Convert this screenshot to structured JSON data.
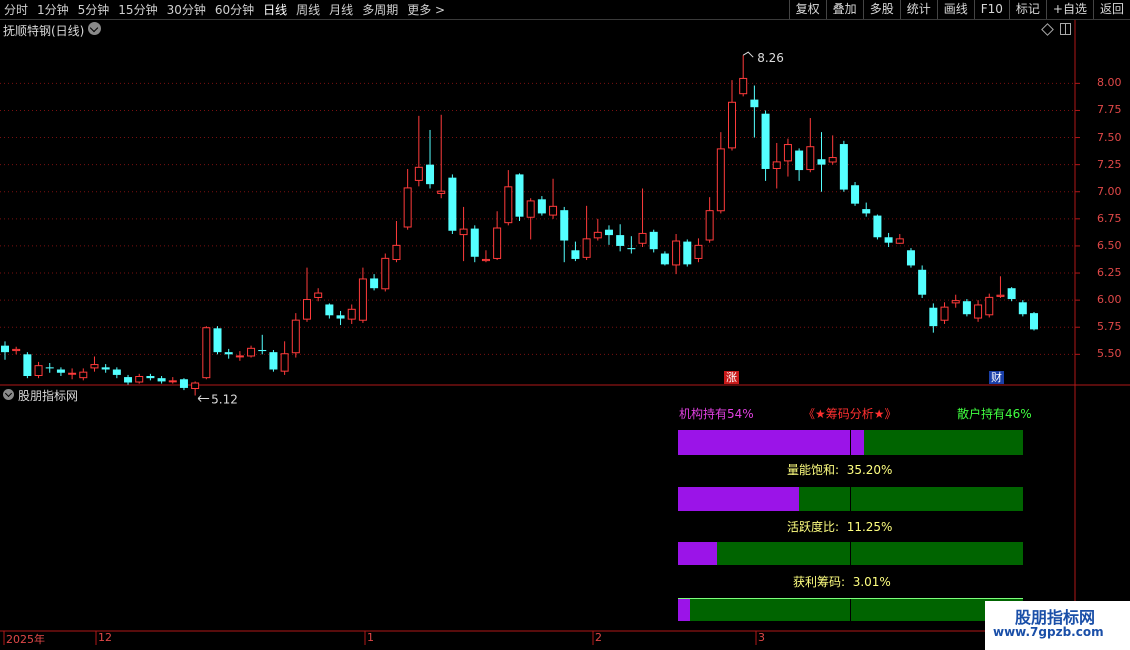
{
  "toolbar": {
    "periods": [
      "分时",
      "1分钟",
      "5分钟",
      "15分钟",
      "30分钟",
      "60分钟",
      "日线",
      "周线",
      "月线",
      "多周期",
      "更多 >"
    ],
    "active_period": "日线",
    "actions": [
      "复权",
      "叠加",
      "多股",
      "统计",
      "画线",
      "F10",
      "标记",
      "+自选",
      "返回"
    ]
  },
  "main_chart": {
    "stock_title": "抚顺特钢(日线)",
    "high_label": "8.26",
    "low_label": "5.12",
    "price_ticks": [
      "8.00",
      "7.75",
      "7.50",
      "7.25",
      "7.00",
      "6.75",
      "6.50",
      "6.25",
      "6.00",
      "5.75",
      "5.50"
    ],
    "markers": [
      {
        "text": "涨",
        "color": "#c81a1a"
      },
      {
        "text": "财",
        "color": "#1a3fa8"
      }
    ],
    "colors": {
      "up": "#ff3b3b",
      "down": "#54ffff",
      "axis": "#b01818"
    }
  },
  "chart_data": {
    "type": "candlestick",
    "ylim": [
      5.3,
      8.4
    ],
    "candles": [
      [
        5.58,
        5.52,
        5.62,
        5.45
      ],
      [
        5.53,
        5.55,
        5.57,
        5.5
      ],
      [
        5.5,
        5.3,
        5.52,
        5.28
      ],
      [
        5.3,
        5.4,
        5.43,
        5.28
      ],
      [
        5.38,
        5.37,
        5.42,
        5.33
      ],
      [
        5.36,
        5.33,
        5.38,
        5.3
      ],
      [
        5.33,
        5.33,
        5.37,
        5.27
      ],
      [
        5.28,
        5.34,
        5.37,
        5.26
      ],
      [
        5.37,
        5.41,
        5.48,
        5.34
      ],
      [
        5.38,
        5.36,
        5.41,
        5.33
      ],
      [
        5.36,
        5.31,
        5.38,
        5.28
      ],
      [
        5.29,
        5.24,
        5.31,
        5.22
      ],
      [
        5.24,
        5.3,
        5.32,
        5.23
      ],
      [
        5.3,
        5.28,
        5.32,
        5.26
      ],
      [
        5.28,
        5.25,
        5.3,
        5.23
      ],
      [
        5.26,
        5.26,
        5.29,
        5.23
      ],
      [
        5.27,
        5.19,
        5.28,
        5.17
      ],
      [
        5.18,
        5.24,
        5.25,
        5.12
      ],
      [
        5.28,
        5.75,
        5.76,
        5.27
      ],
      [
        5.74,
        5.52,
        5.76,
        5.5
      ],
      [
        5.52,
        5.5,
        5.55,
        5.46
      ],
      [
        5.48,
        5.49,
        5.53,
        5.44
      ],
      [
        5.48,
        5.56,
        5.58,
        5.47
      ],
      [
        5.54,
        5.53,
        5.68,
        5.5
      ],
      [
        5.52,
        5.36,
        5.54,
        5.34
      ],
      [
        5.34,
        5.51,
        5.62,
        5.31
      ],
      [
        5.51,
        5.82,
        5.88,
        5.47
      ],
      [
        5.82,
        6.01,
        6.3,
        5.8
      ],
      [
        6.02,
        6.07,
        6.11,
        5.99
      ],
      [
        5.96,
        5.86,
        5.97,
        5.83
      ],
      [
        5.86,
        5.83,
        5.9,
        5.77
      ],
      [
        5.82,
        5.92,
        5.96,
        5.78
      ],
      [
        5.81,
        6.2,
        6.3,
        5.79
      ],
      [
        6.2,
        6.11,
        6.24,
        6.09
      ],
      [
        6.1,
        6.39,
        6.43,
        6.08
      ],
      [
        6.37,
        6.51,
        6.73,
        6.35
      ],
      [
        6.67,
        7.04,
        7.21,
        6.65
      ],
      [
        7.1,
        7.23,
        7.7,
        7.05
      ],
      [
        7.25,
        7.07,
        7.57,
        7.03
      ],
      [
        6.98,
        7.01,
        7.71,
        6.94
      ],
      [
        7.13,
        6.64,
        7.16,
        6.61
      ],
      [
        6.6,
        6.66,
        6.86,
        6.36
      ],
      [
        6.66,
        6.4,
        6.69,
        6.35
      ],
      [
        6.36,
        6.38,
        6.46,
        6.35
      ],
      [
        6.38,
        6.67,
        6.82,
        6.37
      ],
      [
        6.71,
        7.05,
        7.2,
        6.69
      ],
      [
        7.16,
        6.77,
        7.17,
        6.73
      ],
      [
        6.76,
        6.92,
        6.94,
        6.56
      ],
      [
        6.93,
        6.8,
        6.96,
        6.78
      ],
      [
        6.78,
        6.87,
        7.12,
        6.75
      ],
      [
        6.83,
        6.55,
        6.86,
        6.35
      ],
      [
        6.46,
        6.38,
        6.54,
        6.36
      ],
      [
        6.39,
        6.57,
        6.87,
        6.37
      ],
      [
        6.57,
        6.63,
        6.75,
        6.55
      ],
      [
        6.65,
        6.6,
        6.69,
        6.51
      ],
      [
        6.6,
        6.5,
        6.7,
        6.45
      ],
      [
        6.48,
        6.47,
        6.59,
        6.43
      ],
      [
        6.52,
        6.62,
        7.03,
        6.49
      ],
      [
        6.63,
        6.47,
        6.65,
        6.44
      ],
      [
        6.43,
        6.33,
        6.45,
        6.32
      ],
      [
        6.32,
        6.55,
        6.61,
        6.24
      ],
      [
        6.54,
        6.33,
        6.56,
        6.31
      ],
      [
        6.38,
        6.51,
        6.57,
        6.35
      ],
      [
        6.55,
        6.83,
        6.95,
        6.53
      ],
      [
        6.82,
        7.4,
        7.55,
        6.8
      ],
      [
        7.4,
        7.83,
        8.03,
        7.38
      ],
      [
        7.9,
        8.05,
        8.26,
        7.88
      ],
      [
        7.85,
        7.78,
        7.98,
        7.5
      ],
      [
        7.72,
        7.21,
        7.75,
        7.1
      ],
      [
        7.21,
        7.28,
        7.45,
        7.03
      ],
      [
        7.28,
        7.44,
        7.49,
        7.14
      ],
      [
        7.38,
        7.2,
        7.4,
        7.1
      ],
      [
        7.2,
        7.42,
        7.68,
        7.18
      ],
      [
        7.3,
        7.25,
        7.55,
        7.0
      ],
      [
        7.27,
        7.32,
        7.52,
        7.25
      ],
      [
        7.44,
        7.02,
        7.47,
        7.0
      ],
      [
        7.06,
        6.89,
        7.09,
        6.87
      ],
      [
        6.84,
        6.8,
        6.9,
        6.77
      ],
      [
        6.78,
        6.58,
        6.79,
        6.56
      ],
      [
        6.58,
        6.53,
        6.62,
        6.49
      ],
      [
        6.52,
        6.57,
        6.61,
        6.52
      ],
      [
        6.46,
        6.32,
        6.48,
        6.3
      ],
      [
        6.28,
        6.05,
        6.32,
        6.02
      ],
      [
        5.93,
        5.76,
        5.97,
        5.7
      ],
      [
        5.81,
        5.94,
        5.98,
        5.78
      ],
      [
        5.97,
        6.0,
        6.05,
        5.93
      ],
      [
        5.99,
        5.87,
        6.01,
        5.85
      ],
      [
        5.83,
        5.96,
        6.0,
        5.8
      ],
      [
        5.86,
        6.03,
        6.06,
        5.84
      ],
      [
        6.03,
        6.05,
        6.22,
        6.02
      ],
      [
        6.11,
        6.01,
        6.12,
        5.99
      ],
      [
        5.98,
        5.87,
        6.0,
        5.85
      ],
      [
        5.88,
        5.73,
        5.89,
        5.72
      ]
    ],
    "x_tick_labels": [
      "2025年",
      "12",
      "1",
      "2",
      "3"
    ]
  },
  "indicator": {
    "title": "股朋指标网",
    "header_left": "机构持有54%",
    "header_center": "《★筹码分析★》",
    "header_right": "散户持有46%",
    "inst_pct": 54,
    "rows": [
      {
        "label": "量能饱和:",
        "value": "35.20%",
        "pct": 35.2
      },
      {
        "label": "活跃度比:",
        "value": "11.25%",
        "pct": 11.25
      },
      {
        "label": "获利筹码:",
        "value": "3.01%",
        "pct": 3.01
      }
    ],
    "colors": {
      "purple": "#9b14e8",
      "green": "#006400",
      "magenta": "#e040e0",
      "red": "#ff3030",
      "lime": "#40ff40",
      "yellow": "#ffff80"
    }
  },
  "watermark": {
    "title": "股朋指标网",
    "url": "www.7gpzb.com"
  }
}
